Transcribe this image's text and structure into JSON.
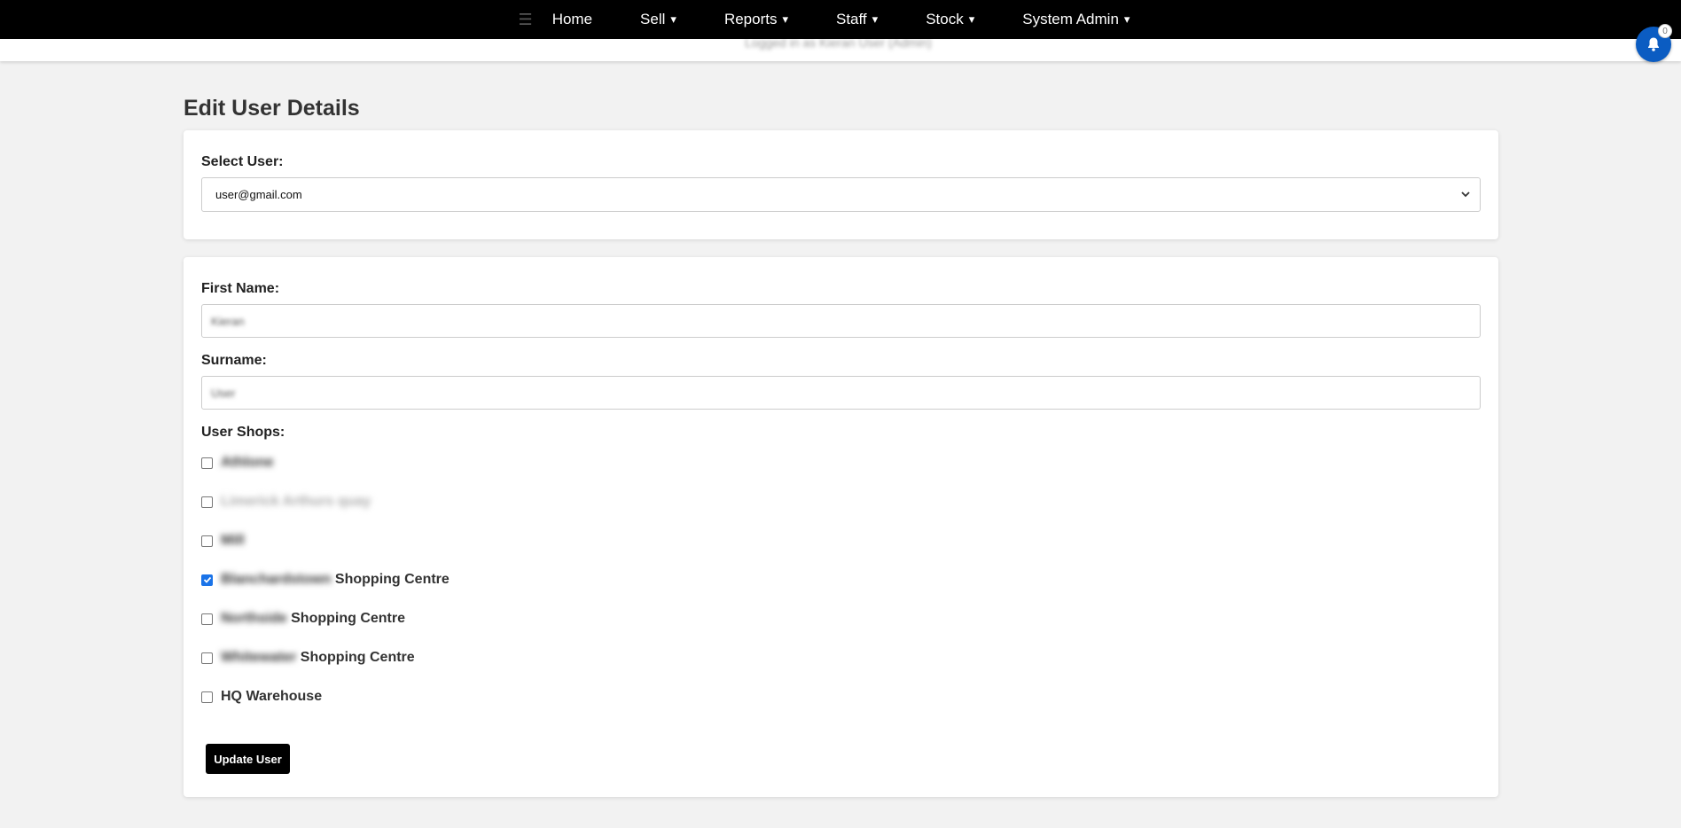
{
  "nav": {
    "menu_icon": "hamburger-icon",
    "items": [
      {
        "label": "Home",
        "dropdown": false
      },
      {
        "label": "Sell",
        "dropdown": true
      },
      {
        "label": "Reports",
        "dropdown": true
      },
      {
        "label": "Staff",
        "dropdown": true
      },
      {
        "label": "Stock",
        "dropdown": true
      },
      {
        "label": "System Admin",
        "dropdown": true
      }
    ],
    "caret": "▾"
  },
  "subbar": {
    "text": "Logged in as Kieran User (Admin)"
  },
  "notifications": {
    "icon": "bell-icon",
    "count": "0",
    "color": "#0b5cc2"
  },
  "page": {
    "title": "Edit User Details"
  },
  "select_user": {
    "label": "Select User:",
    "selected": "user@gmail.com"
  },
  "form": {
    "first_name_label": "First Name:",
    "first_name_value": "Kieran",
    "surname_label": "Surname:",
    "surname_value": "User",
    "shops_label": "User Shops:",
    "shops": [
      {
        "blurred": "Athlone",
        "suffix": "",
        "checked": false,
        "faded": false
      },
      {
        "blurred": "Limerick Arthurs quay",
        "suffix": "",
        "checked": false,
        "faded": true
      },
      {
        "blurred": "Mill",
        "suffix": "",
        "checked": false,
        "faded": false
      },
      {
        "blurred": "Blanchardstown",
        "suffix": "Shopping Centre",
        "checked": true,
        "faded": false
      },
      {
        "blurred": "Northside",
        "suffix": "Shopping Centre",
        "checked": false,
        "faded": false
      },
      {
        "blurred": "Whitewater",
        "suffix": "Shopping Centre",
        "checked": false,
        "faded": false
      },
      {
        "blurred": "",
        "suffix": "HQ Warehouse",
        "checked": false,
        "faded": false
      }
    ],
    "submit_label": "Update User"
  },
  "colors": {
    "navbar": "#000000",
    "accent": "#1a73e8",
    "background": "#f2f2f2"
  }
}
